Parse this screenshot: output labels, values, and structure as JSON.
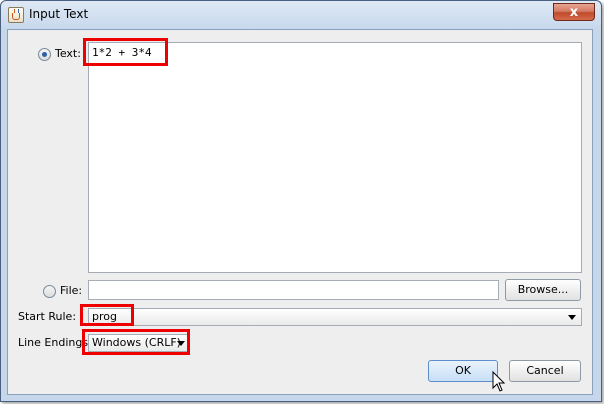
{
  "window": {
    "title": "Input Text",
    "close_glyph": "x"
  },
  "text_option": {
    "label": "Text:",
    "selected": true,
    "value": "1*2 + 3*4"
  },
  "file_option": {
    "label": "File:",
    "selected": false,
    "path": "",
    "browse_label": "Browse..."
  },
  "start_rule": {
    "label": "Start Rule:",
    "value": "prog"
  },
  "line_endings": {
    "label": "Line Endings:",
    "value": "Windows (CRLF)"
  },
  "buttons": {
    "ok": "OK",
    "cancel": "Cancel"
  },
  "icons": {
    "app": "java-cup-icon",
    "close": "close-icon",
    "dropdown": "chevron-down-icon",
    "cursor": "mouse-cursor-icon"
  },
  "colors": {
    "highlight": "#ee0000",
    "radio_selected": "#2b5fa8",
    "close_button": "#c14a2c"
  }
}
